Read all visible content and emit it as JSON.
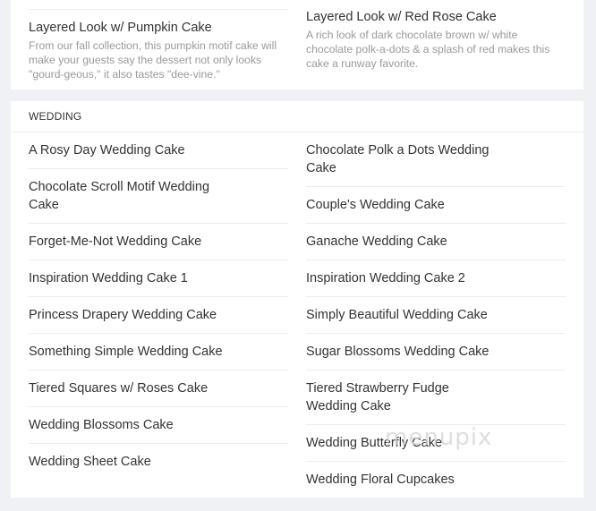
{
  "top_section": {
    "items": [
      {
        "title": "Layered Look w/ Pumpkin Cake",
        "description": "From our fall collection, this pumpkin motif cake will make your guests say the dessert not only looks \"gourd-geous,\" it also tastes \"dee-vine.\""
      },
      {
        "title": "Layered Look w/ Red Rose Cake",
        "description": "A rich look of dark chocolate brown w/ white chocolate polk-a-dots & a splash of red makes this cake a runway favorite."
      }
    ]
  },
  "wedding_section": {
    "heading": "WEDDING",
    "left_items": [
      "A Rosy Day Wedding Cake",
      "Chocolate Scroll Motif Wedding Cake",
      "Forget-Me-Not Wedding Cake",
      "Inspiration Wedding Cake 1",
      "Princess Drapery Wedding Cake",
      "Something Simple Wedding Cake",
      "Tiered Squares w/ Roses Cake",
      "Wedding Blossoms Cake",
      "Wedding Sheet Cake"
    ],
    "right_items": [
      "Chocolate Polk a Dots Wedding Cake",
      "Couple's Wedding Cake",
      "Ganache Wedding Cake",
      "Inspiration Wedding Cake 2",
      "Simply Beautiful Wedding Cake",
      "Sugar Blossoms Wedding Cake",
      "Tiered Strawberry Fudge Wedding Cake",
      "Wedding Butterfly Cake",
      "Wedding Floral Cupcakes"
    ]
  },
  "watermark": "menupix"
}
